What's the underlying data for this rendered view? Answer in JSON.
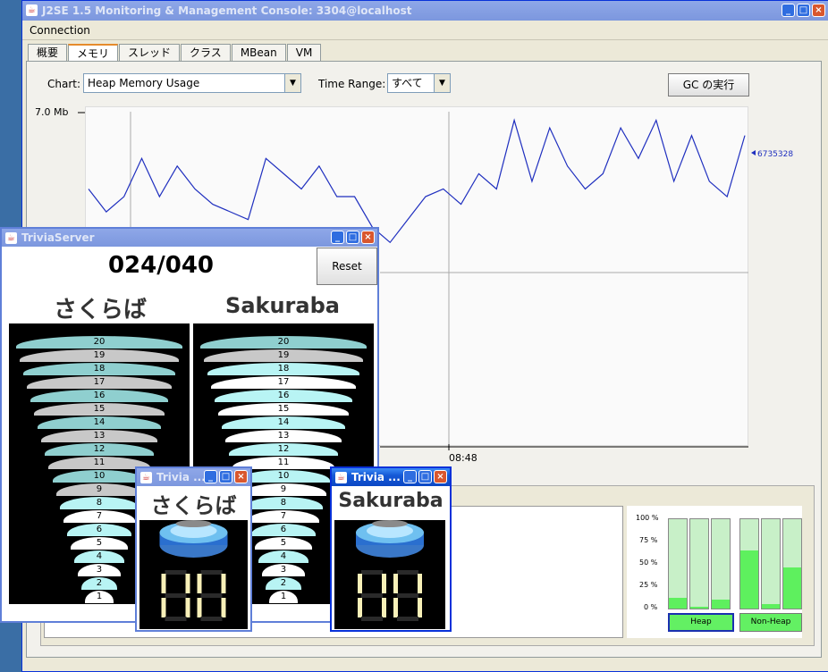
{
  "main_window": {
    "title": "J2SE 1.5 Monitoring & Management Console: 3304@localhost",
    "menu": [
      "Connection"
    ],
    "tabs": [
      "概要",
      "メモリ",
      "スレッド",
      "クラス",
      "MBean",
      "VM"
    ],
    "selected_tab": "メモリ",
    "chart_label": "Chart:",
    "chart_select": "Heap Memory Usage",
    "time_range_label": "Time Range:",
    "time_range_select": "すべて",
    "gc_button": "GC の実行",
    "y_axis_max": "7.0 Mb",
    "x_tick": "08:48",
    "current_value": "6735328",
    "bar_labels": [
      "100 %",
      "75 %",
      "50 %",
      "25 %",
      "0 %"
    ],
    "heap_label": "Heap",
    "nonheap_label": "Non-Heap",
    "heap_bars": [
      0.12,
      0.02,
      0.1
    ],
    "nonheap_bars": [
      0.65,
      0.05,
      0.46
    ]
  },
  "chart_data": {
    "type": "line",
    "title": "",
    "ylabel": "",
    "ylim_label": "7.0 Mb",
    "series": [
      {
        "values": [
          6.0,
          5.7,
          5.9,
          6.4,
          5.9,
          6.3,
          6.0,
          5.8,
          5.7,
          5.6,
          6.4,
          6.2,
          6.0,
          6.3,
          5.9,
          5.9,
          5.5,
          5.3,
          5.6,
          5.9,
          6.0,
          5.8,
          6.2,
          6.0,
          6.9,
          6.1,
          6.8,
          6.3,
          6.0,
          6.2,
          6.8,
          6.4,
          6.9,
          6.1,
          6.7,
          6.1,
          5.9,
          6.7
        ]
      }
    ]
  },
  "trivia_server": {
    "title": "TriviaServer",
    "score": "024/040",
    "reset_button": "Reset",
    "player1_name": "さくらば",
    "player2_name": "Sakuraba",
    "scale": [
      "20",
      "19",
      "18",
      "17",
      "16",
      "15",
      "14",
      "13",
      "12",
      "11",
      "10",
      "9",
      "8",
      "7",
      "6",
      "5",
      "4",
      "3",
      "2",
      "1"
    ],
    "player1_level": 8,
    "player2_level": 18
  },
  "trivia_client1": {
    "title": "Trivia ...",
    "name": "さくらば"
  },
  "trivia_client2": {
    "title": "Trivia ...",
    "name": "Sakuraba"
  }
}
